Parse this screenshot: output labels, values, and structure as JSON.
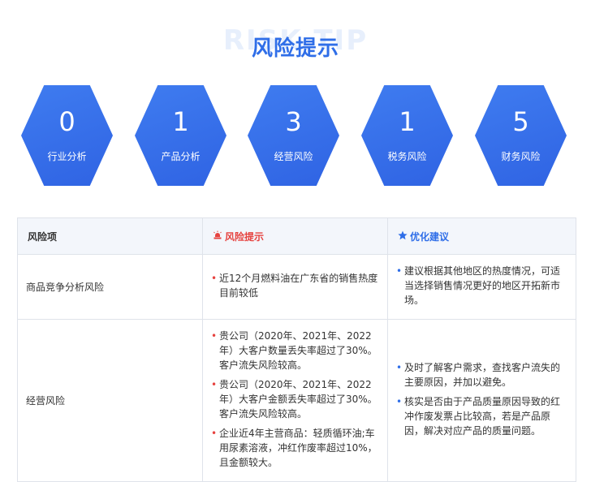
{
  "header": {
    "watermark": "RISK TIP",
    "title": "风险提示"
  },
  "stats": [
    {
      "value": "0",
      "label": "行业分析"
    },
    {
      "value": "1",
      "label": "产品分析"
    },
    {
      "value": "3",
      "label": "经营风险"
    },
    {
      "value": "1",
      "label": "税务风险"
    },
    {
      "value": "5",
      "label": "财务风险"
    }
  ],
  "table": {
    "headers": {
      "risk": "风险项",
      "tip": "风险提示",
      "advice": "优化建议"
    },
    "rows": [
      {
        "risk": "商品竞争分析风险",
        "tips": [
          "近12个月燃料油在广东省的销售热度目前较低"
        ],
        "advice": [
          "建议根据其他地区的热度情况，可适当选择销售情况更好的地区开拓新市场。"
        ]
      },
      {
        "risk": "经营风险",
        "tips": [
          "贵公司（2020年、2021年、2022年）大客户数量丢失率超过了30%。客户流失风险较高。",
          "贵公司（2020年、2021年、2022年）大客户金额丢失率超过了30%。客户流失风险较高。",
          "企业近4年主营商品：轻质循环油;车用尿素溶液，冲红作废率超过10%，且金额较大。"
        ],
        "advice": [
          "及时了解客户需求，查找客户流失的主要原因，并加以避免。",
          "核实是否由于产品质量原因导致的红冲作废发票占比较高，若是产品原因，解决对应产品的质量问题。"
        ]
      }
    ]
  },
  "colors": {
    "accent": "#2f6ee8",
    "warning": "#e6423f"
  },
  "icons": {
    "tip": "alarm-icon",
    "advice": "star-icon"
  }
}
